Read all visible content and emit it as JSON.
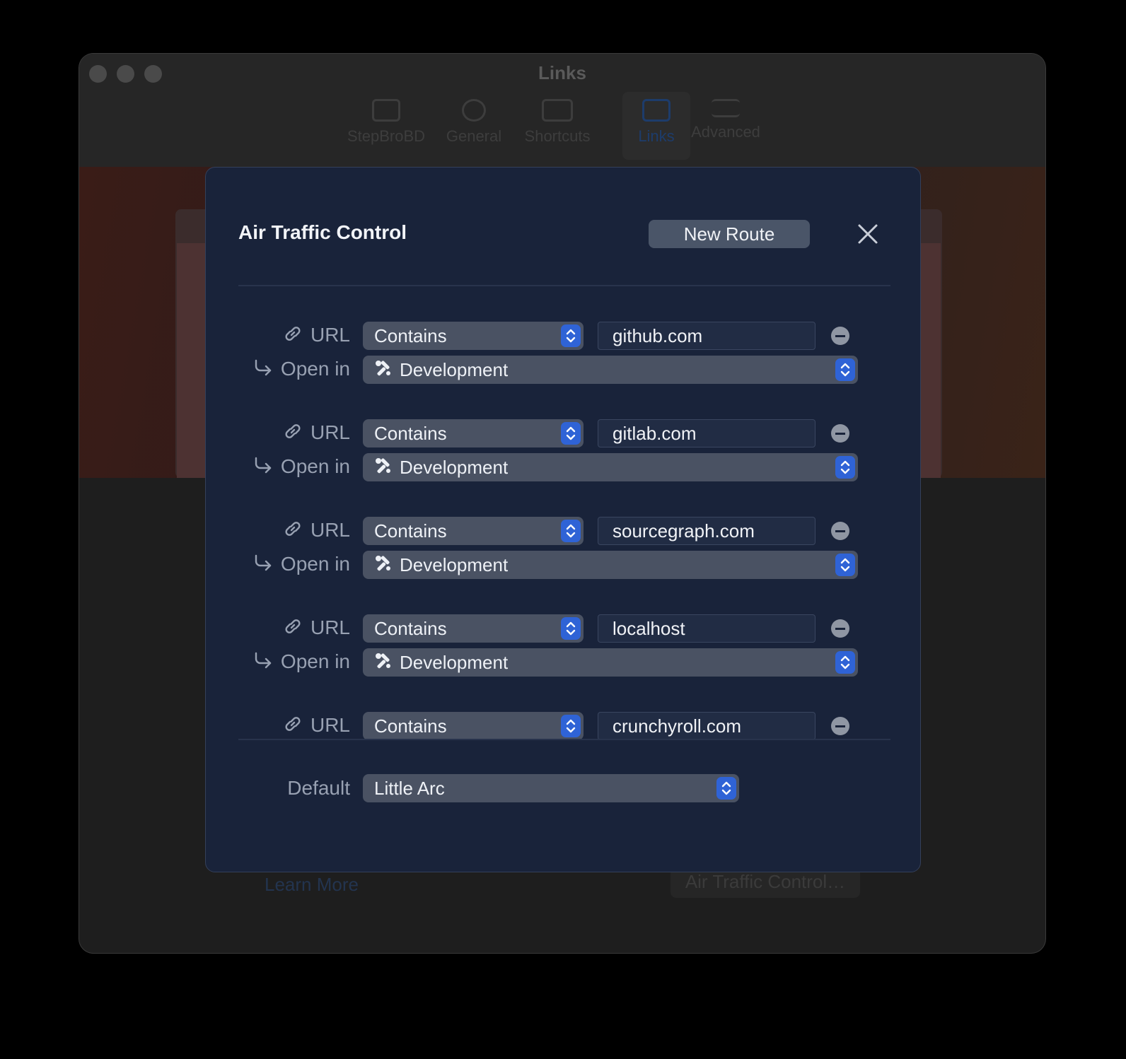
{
  "window": {
    "title": "Links",
    "toolbar": [
      {
        "label": "StepBroBD",
        "icon": "keyboard-icon"
      },
      {
        "label": "General",
        "icon": "gear-icon"
      },
      {
        "label": "Shortcuts",
        "icon": "keyboard-icon"
      },
      {
        "label": "Links",
        "icon": "browser-icon"
      },
      {
        "label": "Advanced",
        "icon": "sliders-icon"
      }
    ],
    "background_link": "Learn More",
    "background_button": "Air Traffic Control…"
  },
  "sheet": {
    "title": "Air Traffic Control",
    "new_route_label": "New Route",
    "url_label": "URL",
    "open_in_label": "Open in",
    "routes": [
      {
        "match": "Contains",
        "value": "github.com",
        "open_in": "Development"
      },
      {
        "match": "Contains",
        "value": "gitlab.com",
        "open_in": "Development"
      },
      {
        "match": "Contains",
        "value": "sourcegraph.com",
        "open_in": "Development"
      },
      {
        "match": "Contains",
        "value": "localhost",
        "open_in": "Development"
      },
      {
        "match": "Contains",
        "value": "crunchyroll.com"
      }
    ],
    "default_label": "Default",
    "default_value": "Little Arc"
  },
  "colors": {
    "sheet_bg": "#19233a",
    "accent": "#2f63d6"
  }
}
